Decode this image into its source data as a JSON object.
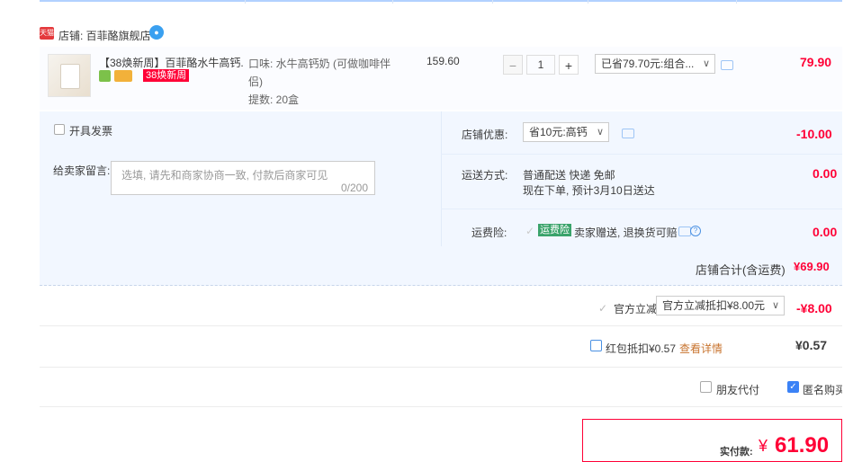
{
  "shop": {
    "tmall_logo": "天猫",
    "name": "店铺: 百菲酪旗舰店",
    "wangwang_icon": "chat-bubble-icon"
  },
  "item": {
    "title": "【38焕新周】百菲酪水牛高钙...",
    "promo_tag": "38焕新周",
    "spec": [
      "口味: 水牛高钙奶 (可做咖啡伴侣)",
      "提数: 20盒"
    ],
    "price": "159.60",
    "quantity": "1",
    "qty_minus": "−",
    "qty_plus": "+",
    "discount_select": "已省79.70元:组合...",
    "subtotal": "79.90"
  },
  "invoice_label": "开具发票",
  "message": {
    "label": "给卖家留言:",
    "placeholder": "选填, 请先和商家协商一致, 付款后商家可见",
    "counter": "0/200"
  },
  "shop_discount": {
    "label": "店铺优惠:",
    "select": "省10元:高钙",
    "amount": "-10.00"
  },
  "shipping": {
    "label": "运送方式:",
    "line1": "普通配送 快递 免邮",
    "line2": "现在下单, 预计3月10日送达",
    "amount": "0.00"
  },
  "insurance": {
    "label": "运费险:",
    "tag": "运费险",
    "text": "卖家赠送, 退换货可赔",
    "help": "?",
    "amount": "0.00"
  },
  "shop_total": {
    "label": "店铺合计(含运费)",
    "amount": "¥69.90"
  },
  "official": {
    "label": "官方立减",
    "select": "官方立减抵扣¥8.00元",
    "amount": "-¥8.00"
  },
  "redpacket": {
    "label": "红包抵扣¥0.57",
    "link": "查看详情",
    "amount": "¥0.57"
  },
  "friend_pay": "朋友代付",
  "anonymous": "匿名购买",
  "final": {
    "label": "实付款:",
    "currency": "¥",
    "amount": "61.90"
  },
  "colors": {
    "accent_red": "#ff0036",
    "panel_blue": "#f2f7ff",
    "link_orange": "#c8742f"
  }
}
